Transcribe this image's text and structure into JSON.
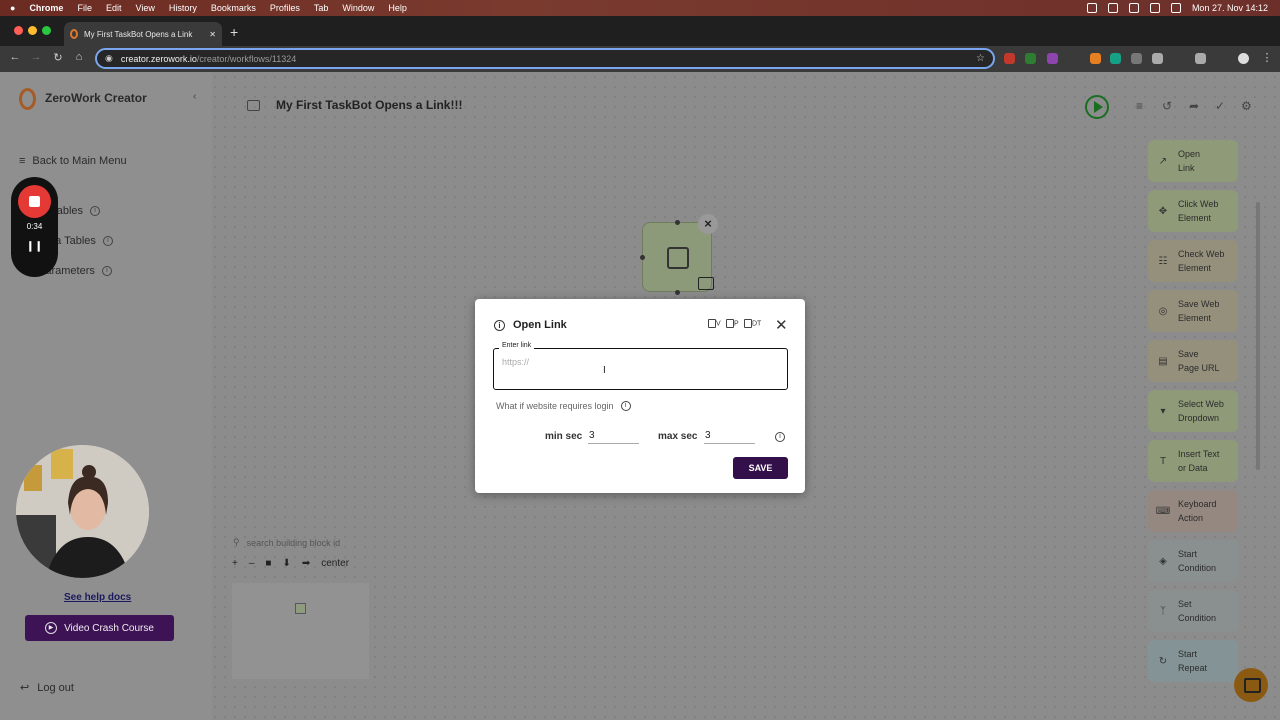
{
  "menubar": {
    "apple": "",
    "app": "Chrome",
    "items": [
      "File",
      "Edit",
      "View",
      "History",
      "Bookmarks",
      "Profiles",
      "Tab",
      "Window",
      "Help"
    ],
    "datetime": "Mon 27. Nov  14:12"
  },
  "browser": {
    "tab_title": "My First TaskBot Opens a Link",
    "url_host": "creator.zerowork.io",
    "url_path": "/creator/workflows/11324"
  },
  "sidebar": {
    "brand": "ZeroWork Creator",
    "back": "Back to Main Menu",
    "items": [
      {
        "label": "Variables"
      },
      {
        "label": "Data Tables"
      },
      {
        "label": "Parameters"
      }
    ],
    "help_link": "See help docs",
    "crash_course": "Video Crash Course",
    "logout": "Log out"
  },
  "recorder": {
    "time": "0:34"
  },
  "workflow": {
    "title": "My First TaskBot Opens a Link!!!"
  },
  "blocks": [
    {
      "line1": "Open",
      "line2": "Link",
      "icon": "external-link-icon",
      "color": "#8e9a78"
    },
    {
      "line1": "Click Web",
      "line2": "Element",
      "icon": "click-icon",
      "color": "#8e9a78"
    },
    {
      "line1": "Check Web",
      "line2": "Element",
      "icon": "check-icon",
      "color": "#95907c"
    },
    {
      "line1": "Save Web",
      "line2": "Element",
      "icon": "globe-icon",
      "color": "#95907c"
    },
    {
      "line1": "Save",
      "line2": "Page URL",
      "icon": "page-icon",
      "color": "#95907c"
    },
    {
      "line1": "Select Web",
      "line2": "Dropdown",
      "icon": "dropdown-icon",
      "color": "#8e9a78"
    },
    {
      "line1": "Insert Text",
      "line2": "or Data",
      "icon": "text-icon",
      "color": "#8e9a78"
    },
    {
      "line1": "Keyboard",
      "line2": "Action",
      "icon": "keyboard-icon",
      "color": "#958880"
    },
    {
      "line1": "Start",
      "line2": "Condition",
      "icon": "condition-icon",
      "color": "#8a9090"
    },
    {
      "line1": "Set",
      "line2": "Condition",
      "icon": "set-condition-icon",
      "color": "#8a9090"
    },
    {
      "line1": "Start",
      "line2": "Repeat",
      "icon": "repeat-icon",
      "color": "#849496"
    }
  ],
  "canvas": {
    "search_placeholder": "search building block id",
    "center": "center"
  },
  "modal": {
    "title": "Open Link",
    "tool_v": "V",
    "tool_p": "P",
    "tool_dt": "DT",
    "field_label": "Enter link",
    "placeholder": "https://",
    "login_hint": "What if website requires login",
    "min_label": "min sec",
    "min_value": "3",
    "max_label": "max sec",
    "max_value": "3",
    "save": "SAVE"
  }
}
